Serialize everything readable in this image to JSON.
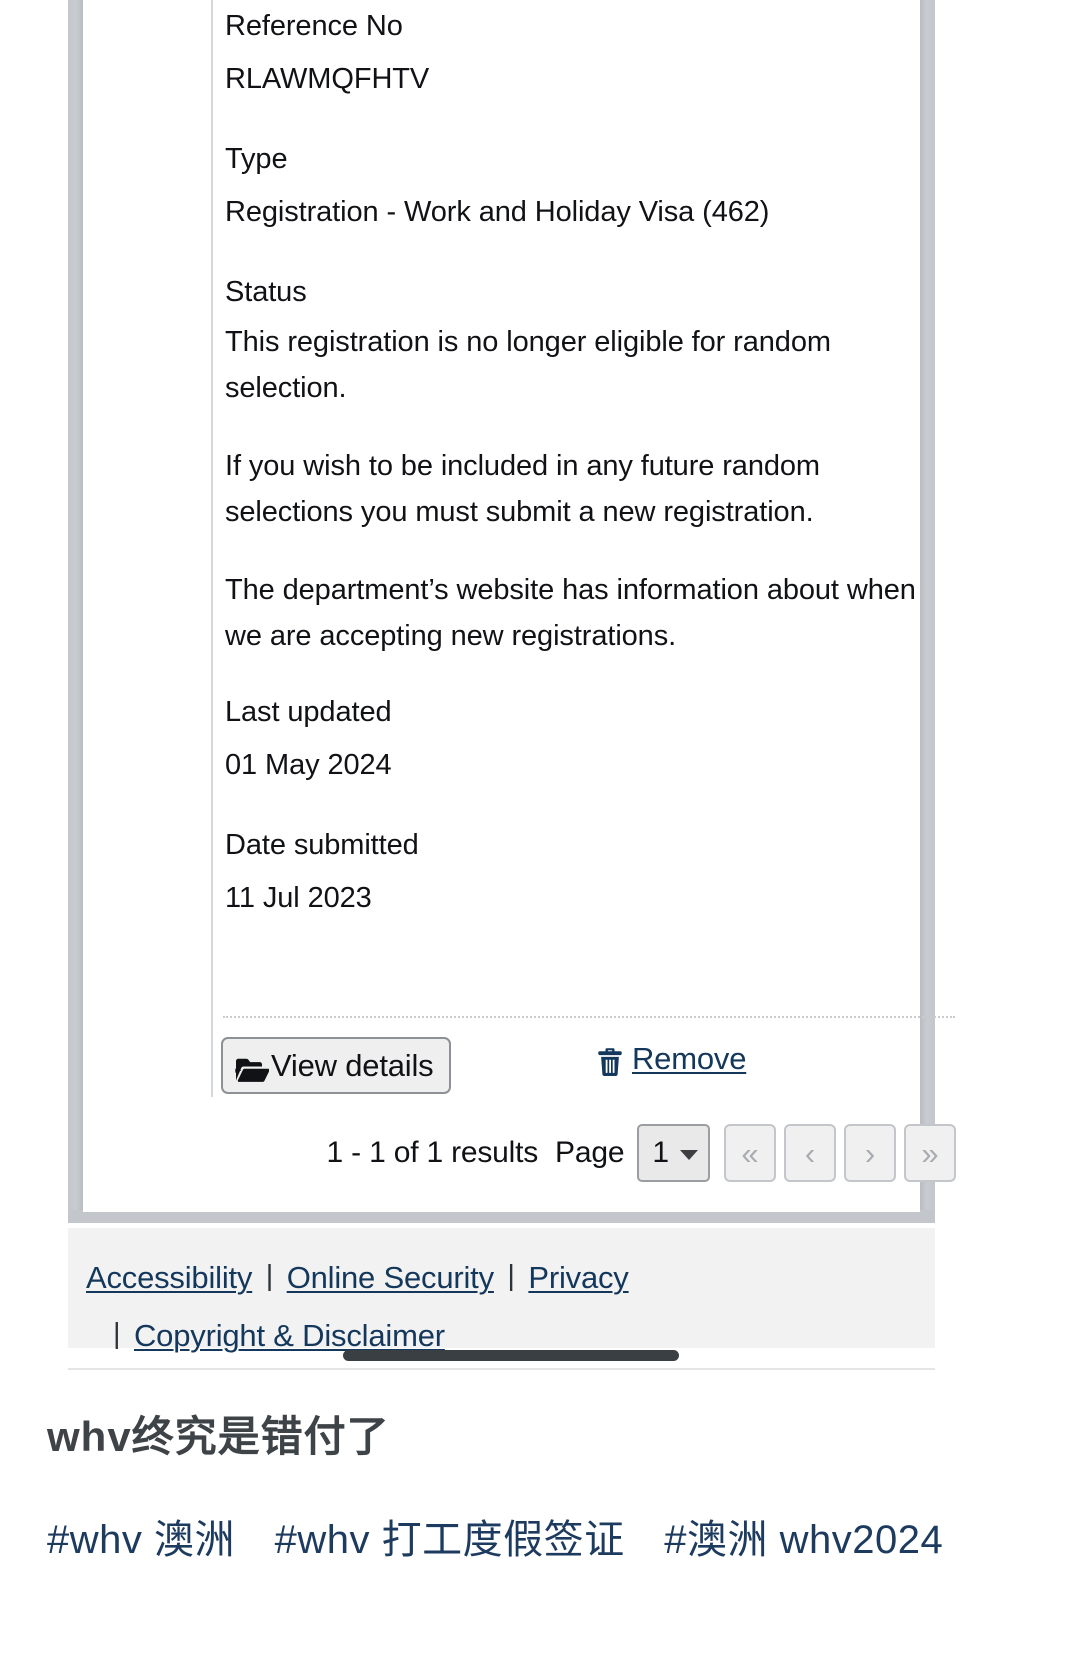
{
  "record": {
    "reference_label": "Reference No",
    "reference_value": "RLAWMQFHTV",
    "type_label": "Type",
    "type_value": "Registration - Work and Holiday Visa (462)",
    "status_label": "Status",
    "status_p1": "This registration is no longer eligible for random selection.",
    "status_p2": "If you wish to be included in any future random selections you must submit a new registration.",
    "status_p3": "The department’s website has information about when we are accepting new registrations.",
    "last_updated_label": "Last updated",
    "last_updated_value": "01 May 2024",
    "date_submitted_label": "Date submitted",
    "date_submitted_value": "11 Jul 2023"
  },
  "actions": {
    "view_details_label": "View details",
    "view_details_icon": "folder-open-icon",
    "remove_label": "Remove",
    "remove_icon": "trash-icon"
  },
  "pagination": {
    "results_text": "1 - 1 of 1 results",
    "page_label": "Page",
    "page_value": "1",
    "page_options": [
      "1"
    ],
    "first_icon": "«",
    "prev_icon": "‹",
    "next_icon": "›",
    "last_icon": "»"
  },
  "footer": {
    "links": [
      {
        "label": "Accessibility"
      },
      {
        "label": "Online Security"
      },
      {
        "label": "Privacy"
      },
      {
        "label": "Copyright & Disclaimer"
      }
    ],
    "separator": "|"
  },
  "caption": {
    "title": "whv终究是错付了",
    "tags": [
      "#whv 澳洲",
      "#whv 打工度假签证",
      "#澳洲 whv2024"
    ]
  },
  "colors": {
    "link": "#14375c",
    "caption_title": "#3e4348",
    "caption_tag": "#1d3a5f",
    "frame": "#c3c7cb",
    "footer_bg": "#f2f2f2"
  }
}
